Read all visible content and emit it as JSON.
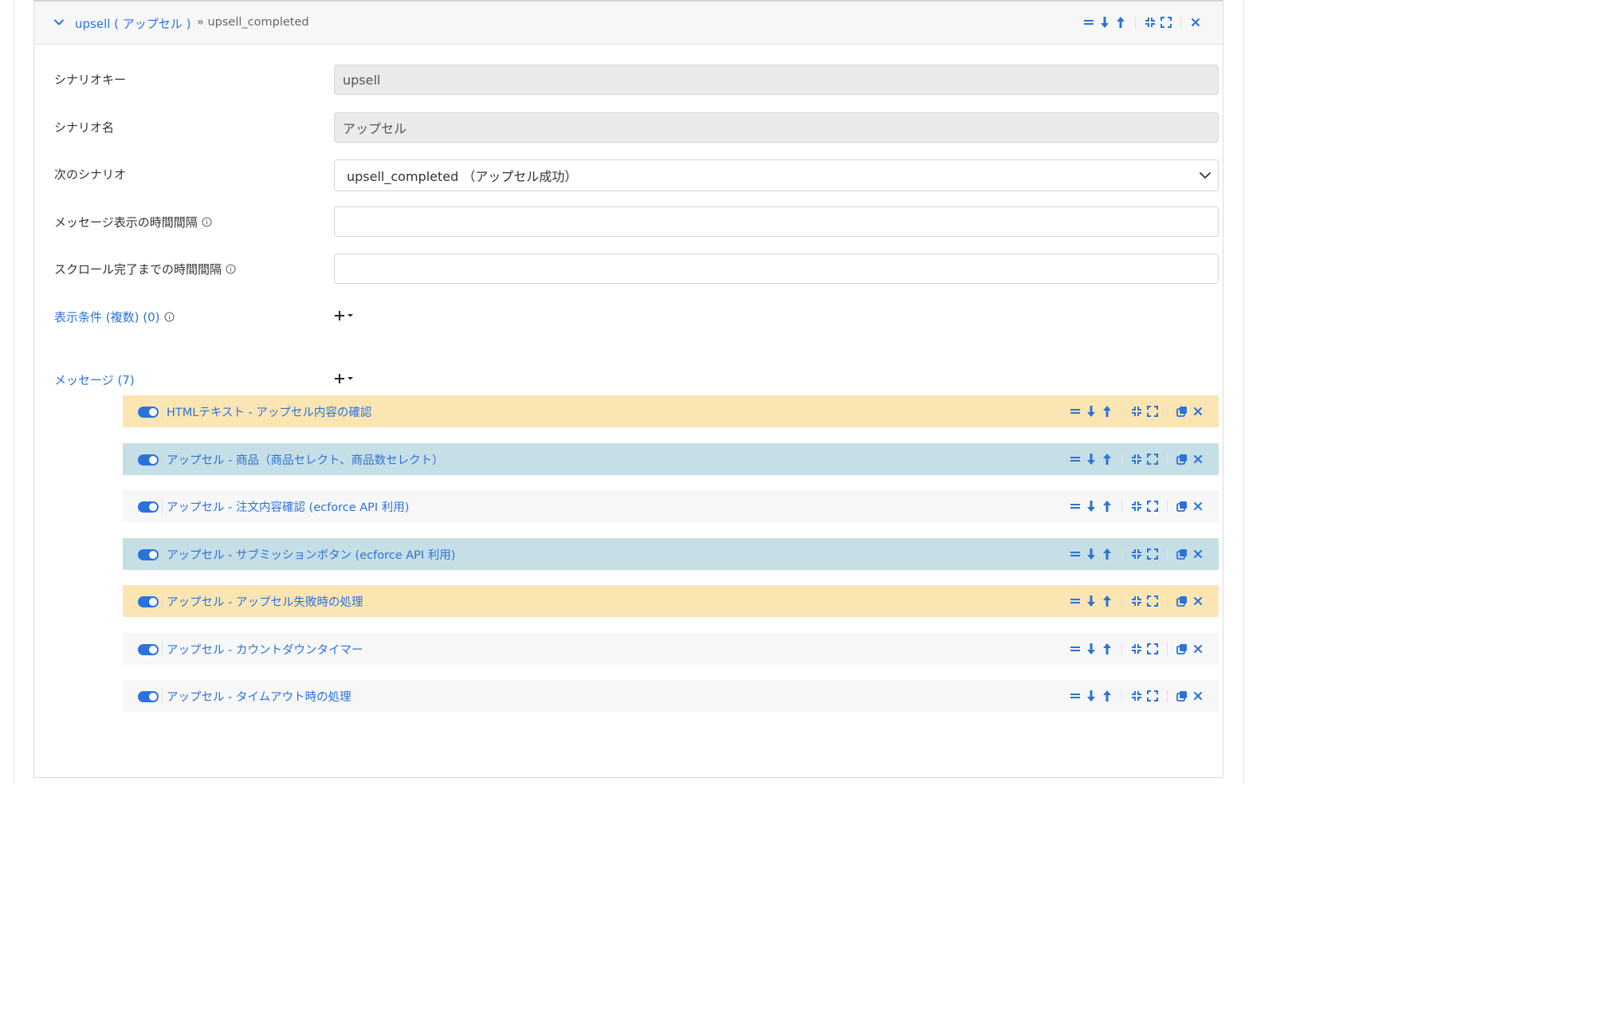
{
  "scenario": {
    "header_title": "upsell ( アップセル )",
    "header_next": "» upsell_completed",
    "fields": {
      "key_label": "シナリオキー",
      "key_value": "upsell",
      "name_label": "シナリオ名",
      "name_value": "アップセル",
      "next_label": "次のシナリオ",
      "next_value": "upsell_completed （アップセル成功）",
      "msg_interval_label": "メッセージ表示の時間間隔",
      "msg_interval_value": "",
      "scroll_interval_label": "スクロール完了までの時間間隔",
      "scroll_interval_value": ""
    },
    "conditions_label": "表示条件 (複数) (0)",
    "messages_label": "メッセージ (7)"
  },
  "messages": [
    {
      "label": "HTMLテキスト - アップセル内容の確認",
      "color": "#fbe5b3",
      "enabled": true
    },
    {
      "label": "アップセル - 商品（商品セレクト、商品数セレクト）",
      "color": "#c6dfe6",
      "enabled": true
    },
    {
      "label": "アップセル - 注文内容確認 (ecforce API 利用)",
      "color": "#f7f7f8",
      "enabled": true
    },
    {
      "label": "アップセル - サブミッションボタン (ecforce API 利用)",
      "color": "#c6dfe6",
      "enabled": true
    },
    {
      "label": "アップセル - アップセル失敗時の処理",
      "color": "#fbe5b3",
      "enabled": true
    },
    {
      "label": "アップセル - カウントダウンタイマー",
      "color": "#f7f7f8",
      "enabled": true
    },
    {
      "label": "アップセル - タイムアウト時の処理",
      "color": "#f7f7f8",
      "enabled": true
    }
  ],
  "colors": {
    "accent": "#2a73d9",
    "row_yellow": "#fbe5b3",
    "row_blue": "#c6dfe6",
    "row_gray": "#f7f7f8",
    "disabled_field": "#e9eaec"
  },
  "icons": {
    "header": [
      "reorder-icon",
      "move-down-icon",
      "move-up-icon",
      "collapse-icon",
      "expand-icon",
      "close-icon"
    ],
    "row": [
      "reorder-icon",
      "move-down-icon",
      "move-up-icon",
      "collapse-icon",
      "expand-icon",
      "copy-icon",
      "close-icon"
    ]
  }
}
